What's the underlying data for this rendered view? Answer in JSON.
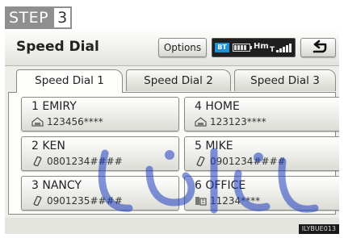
{
  "step": {
    "word": "STEP",
    "number": "3"
  },
  "header": {
    "title": "Speed Dial",
    "options_label": "Options",
    "status": {
      "bluetooth": "BT",
      "mode": "Hm"
    }
  },
  "tabs": [
    {
      "label": "Speed Dial 1",
      "active": true
    },
    {
      "label": "Speed Dial 2",
      "active": false
    },
    {
      "label": "Speed Dial 3",
      "active": false
    }
  ],
  "entries": [
    {
      "name": "1 EMIRY",
      "number": "123456****",
      "icon": "home-phone-icon"
    },
    {
      "name": "4 HOME",
      "number": "123123****",
      "icon": "home-phone-icon"
    },
    {
      "name": "2 KEN",
      "number": "0801234####",
      "icon": "mobile-phone-icon"
    },
    {
      "name": "5 MIKE",
      "number": "0901234####",
      "icon": "mobile-phone-icon"
    },
    {
      "name": "3 NANCY",
      "number": "0901235####",
      "icon": "mobile-phone-icon"
    },
    {
      "name": "6 OFFICE",
      "number": "11234****",
      "icon": "office-phone-icon"
    }
  ],
  "image_code": "ILYBUE013",
  "colors": {
    "bluetooth": "#1e90d8",
    "watermark": "#1f3fbf"
  }
}
